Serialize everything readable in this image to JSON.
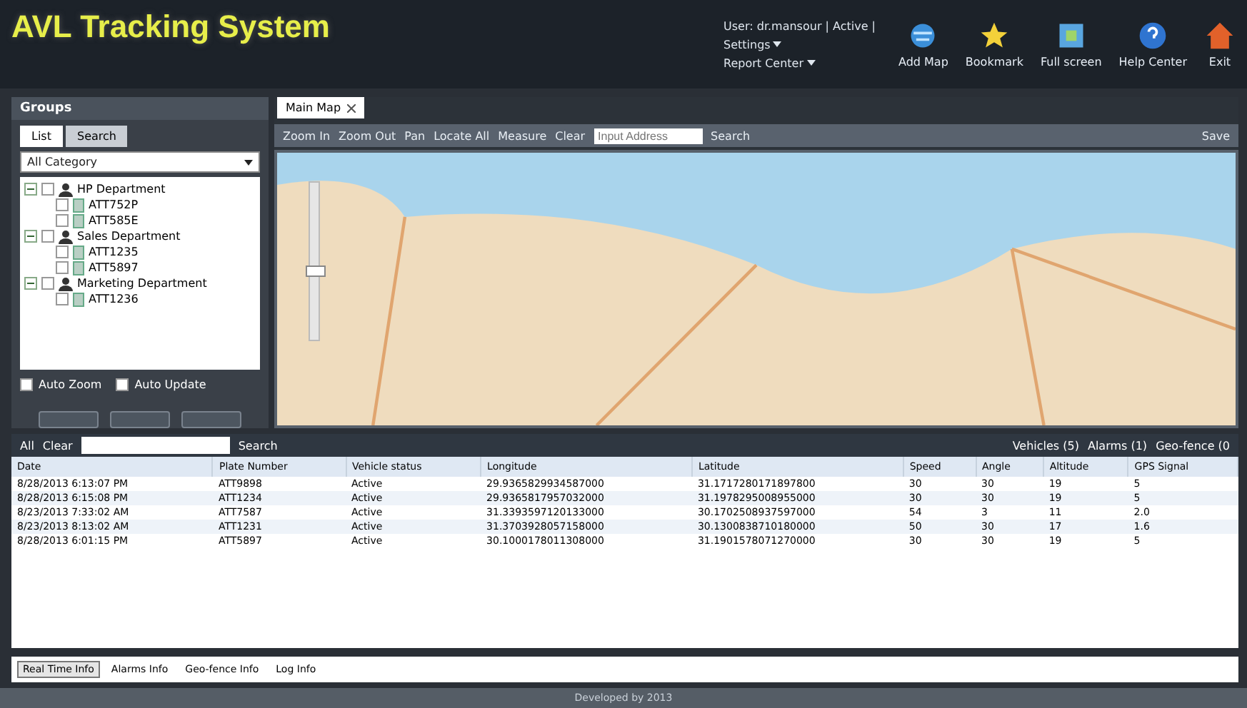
{
  "header": {
    "title": "AVL Tracking System",
    "user": "User: dr.mansour | Active |",
    "menus": [
      "Settings",
      "Report Center"
    ],
    "tools": [
      {
        "kind": "globe",
        "label": "Add Map"
      },
      {
        "kind": "star",
        "label": "Bookmark"
      },
      {
        "kind": "screen",
        "label": "Full screen"
      },
      {
        "kind": "help",
        "label": "Help Center"
      },
      {
        "kind": "home",
        "label": "Exit"
      }
    ]
  },
  "groups": {
    "title": "Groups",
    "tabs": [
      {
        "label": "List",
        "selected": true
      },
      {
        "label": "Search",
        "selected": false
      }
    ],
    "category": "All Category",
    "tree": [
      {
        "label": "HP Department",
        "expanded": true,
        "checked": false,
        "children": [
          {
            "label": "ATT752P",
            "checked": false
          },
          {
            "label": "ATT585E",
            "checked": false
          }
        ]
      },
      {
        "label": "Sales Department",
        "expanded": true,
        "checked": false,
        "children": [
          {
            "label": "ATT1235",
            "checked": false
          },
          {
            "label": "ATT5897",
            "checked": false
          }
        ]
      },
      {
        "label": "Marketing Department",
        "expanded": true,
        "checked": false,
        "children": [
          {
            "label": "ATT1236",
            "checked": false
          }
        ]
      }
    ],
    "options": [
      {
        "label": "Auto Zoom",
        "checked": false
      },
      {
        "label": "Auto Update",
        "checked": false
      }
    ]
  },
  "map": {
    "tab": "Main Map",
    "tools": [
      "Zoom In",
      "Zoom Out",
      "Pan",
      "Locate All",
      "Measure",
      "Clear"
    ],
    "address_placeholder": "Input Address",
    "search": "Search",
    "save": "Save",
    "zoom": {
      "level": 0.4
    }
  },
  "list": {
    "tools": [
      "All",
      "Clear"
    ],
    "search": "Search",
    "counters": [
      "Vehicles (5)",
      "Alarms (1)",
      "Geo-fence (0"
    ],
    "columns": [
      "Date",
      "Plate Number",
      "Vehicle status",
      "Longitude",
      "Latitude",
      "Speed",
      "Angle",
      "Altitude",
      "GPS Signal"
    ],
    "rows": [
      [
        "8/28/2013 6:13:07 PM",
        "ATT9898",
        "Active",
        "29.9365829934587000",
        "31.1717280171897800",
        "30",
        "30",
        "19",
        "5"
      ],
      [
        "8/28/2013 6:15:08 PM",
        "ATT1234",
        "Active",
        "29.9365817957032000",
        "31.1978295008955000",
        "30",
        "30",
        "19",
        "5"
      ],
      [
        "8/23/2013 7:33:02 AM",
        "ATT7587",
        "Active",
        "31.3393597120133000",
        "30.1702508937597000",
        "54",
        "3",
        "11",
        "2.0"
      ],
      [
        "8/23/2013 8:13:02 AM",
        "ATT1231",
        "Active",
        "31.3703928057158000",
        "30.1300838710180000",
        "50",
        "30",
        "17",
        "1.6"
      ],
      [
        "8/28/2013 6:01:15 PM",
        "ATT5897",
        "Active",
        "30.1000178011308000",
        "31.1901578071270000",
        "30",
        "30",
        "19",
        "5"
      ]
    ]
  },
  "bottom_tabs": [
    {
      "label": "Real Time Info",
      "selected": true
    },
    {
      "label": "Alarms Info",
      "selected": false
    },
    {
      "label": "Geo-fence Info",
      "selected": false
    },
    {
      "label": "Log Info",
      "selected": false
    }
  ],
  "footer": "Developed by 2013"
}
